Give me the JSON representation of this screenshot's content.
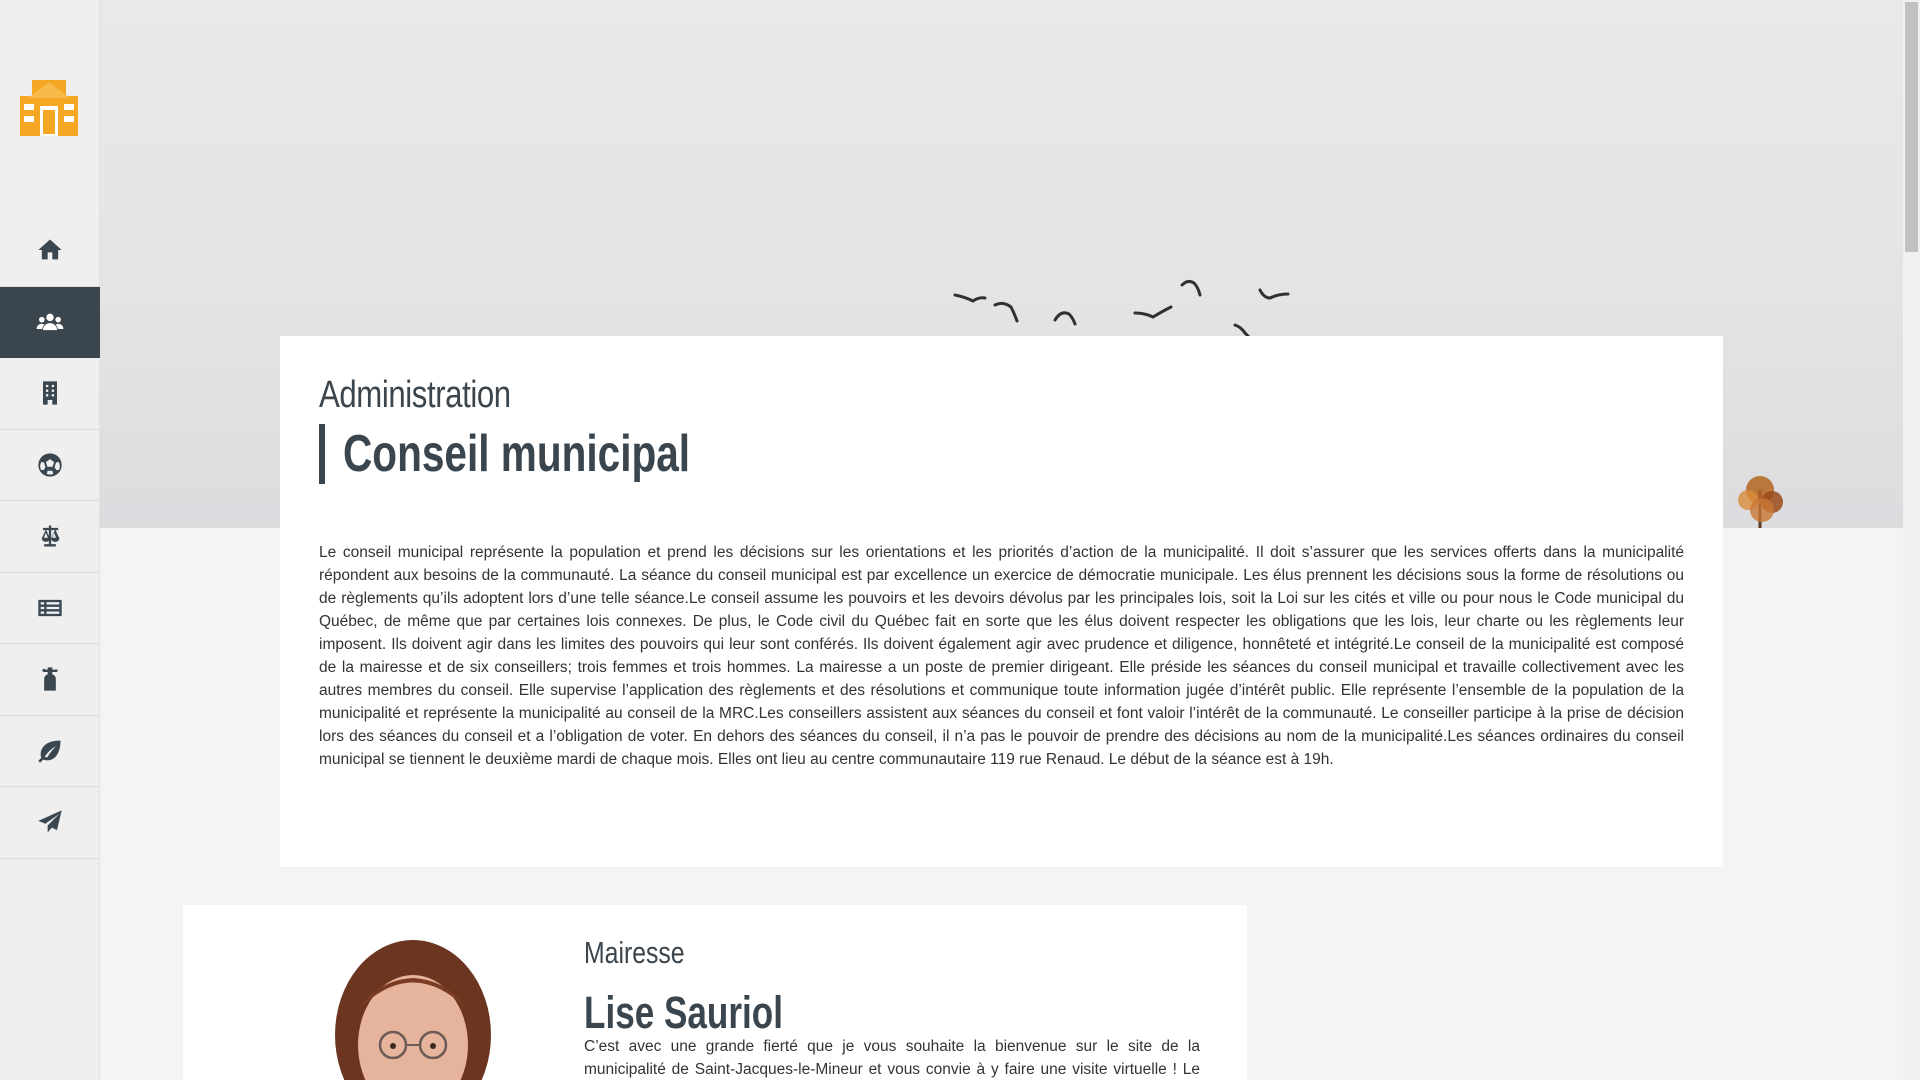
{
  "sidebar": {
    "logo": "municipality-logo",
    "items": [
      {
        "icon": "home-icon",
        "active": false
      },
      {
        "icon": "people-icon",
        "active": true
      },
      {
        "icon": "building-icon",
        "active": false
      },
      {
        "icon": "soccer-ball-icon",
        "active": false
      },
      {
        "icon": "balance-scale-icon",
        "active": false
      },
      {
        "icon": "list-icon",
        "active": false
      },
      {
        "icon": "fire-extinguisher-icon",
        "active": false
      },
      {
        "icon": "leaf-icon",
        "active": false
      },
      {
        "icon": "paper-plane-icon",
        "active": false
      }
    ]
  },
  "colors": {
    "accent": "#3b454d",
    "logo": "#f5a623",
    "background": "#f4f4f4"
  },
  "intro": {
    "kicker": "Administration",
    "title": "Conseil municipal",
    "body": "Le conseil municipal représente la population et prend les décisions sur les orientations et les priorités d’action de la municipalité. Il doit s’assurer que les services offerts dans la municipalité répondent aux besoins de la communauté. La séance du conseil municipal est par excellence un exercice de démocratie municipale. Les élus prennent les décisions sous la forme de résolutions ou de règlements qu’ils adoptent lors d’une telle séance.Le conseil assume les pouvoirs et les devoirs dévolus par les principales lois, soit la Loi sur les cités et ville ou pour nous le Code municipal du Québec, de même que par certaines lois connexes. De plus, le Code civil du Québec fait en sorte que les élus doivent respecter les obligations que les lois, leur charte ou les règlements leur imposent. Ils doivent agir dans les limites des pouvoirs qui leur sont conférés. Ils doivent également agir avec prudence et diligence, honnêteté et intégrité.Le conseil de la municipalité est composé de la mairesse et de six conseillers; trois femmes et trois hommes. La mairesse a un poste de premier dirigeant. Elle préside les séances du conseil municipal et travaille collectivement avec les autres membres du conseil. Elle supervise l’application des règlements et des résolutions et communique toute information jugée d’intérêt public. Elle représente l’ensemble de la population de la municipalité et représente la municipalité au conseil de la MRC.Les conseillers assistent aux séances du conseil et font valoir l’intérêt de la communauté. Le conseiller participe à la prise de décision lors des séances du conseil et a l’obligation de voter. En dehors des séances du conseil, il n’a pas le pouvoir de prendre des décisions au nom de la municipalité.Les séances ordinaires du conseil municipal se tiennent le deuxième mardi de chaque mois. Elles ont lieu au centre communautaire 119 rue Renaud. Le début de la séance est à 19h."
  },
  "mayor": {
    "role": "Mairesse",
    "name": "Lise Sauriol",
    "bio": "C’est avec une grande fierté que je vous souhaite la bienvenue sur le site de la municipalité de Saint-Jacques-le-Mineur et vous convie à y faire une visite virtuelle ! Le site regroupe une"
  }
}
